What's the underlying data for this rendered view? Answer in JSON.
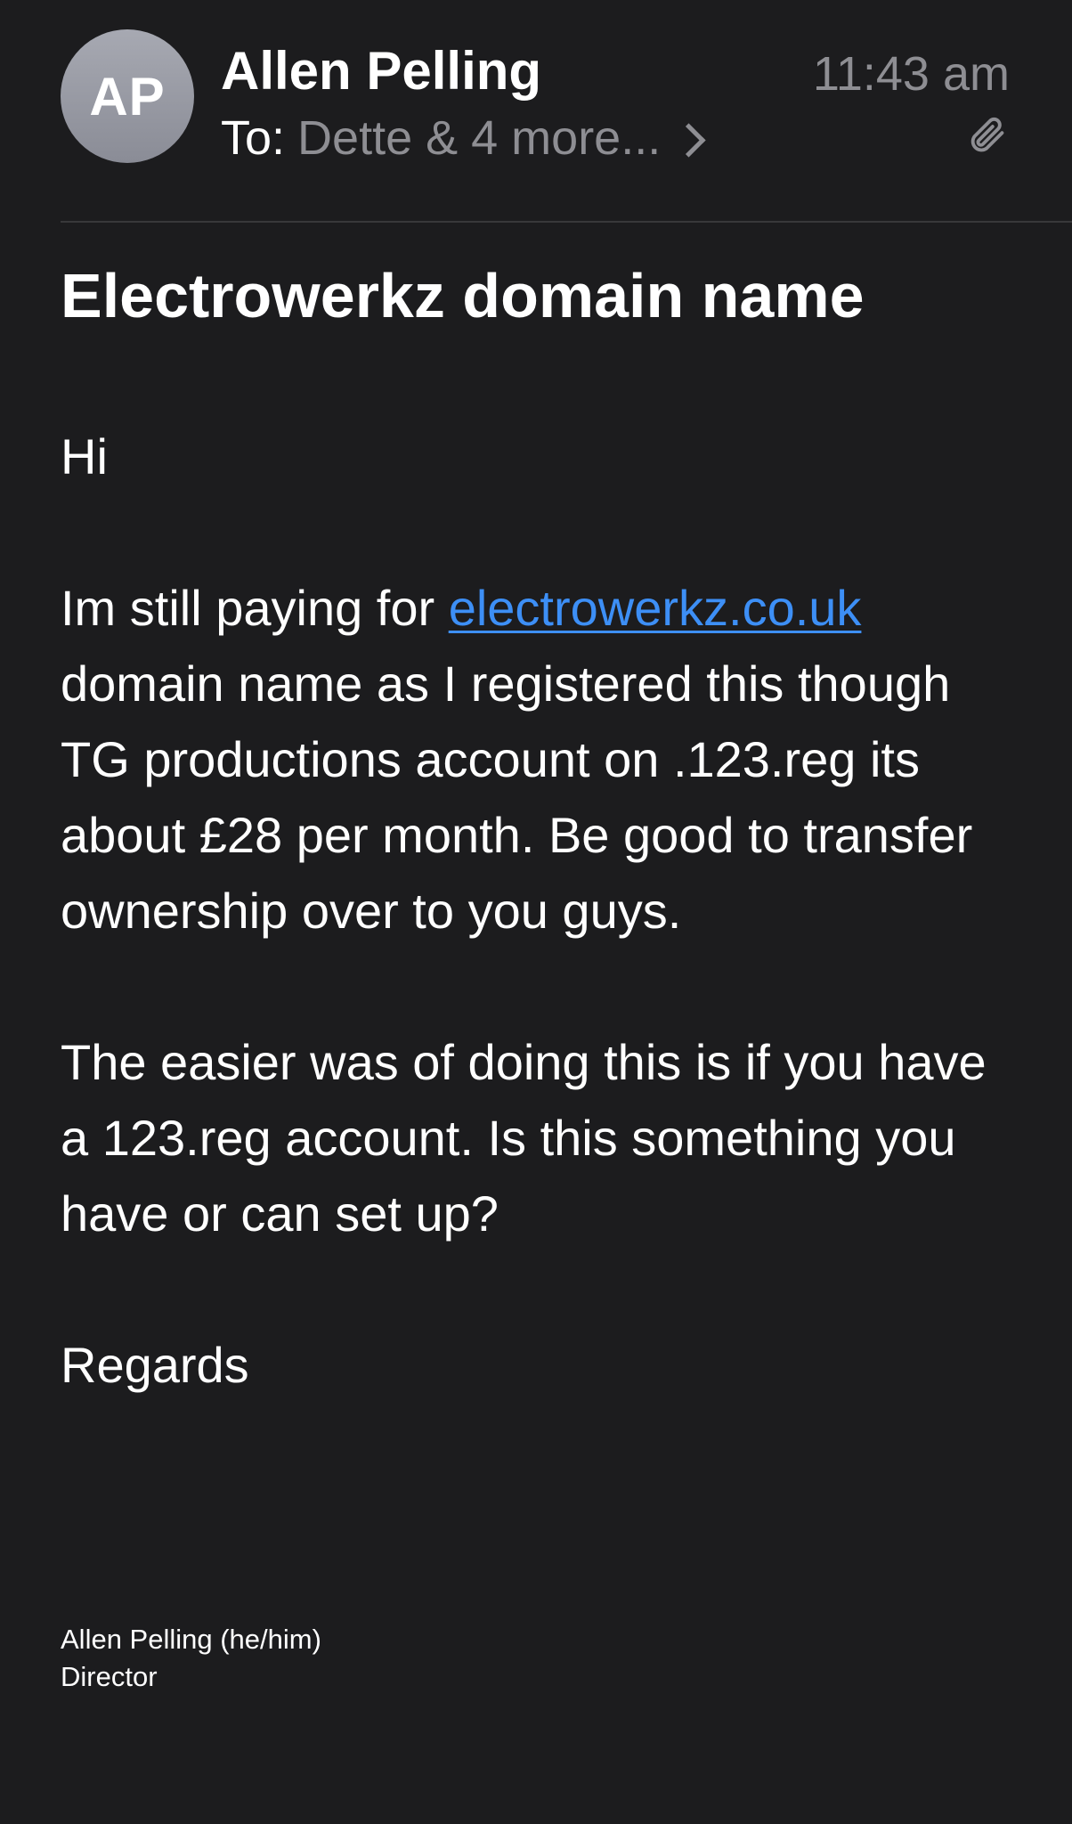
{
  "header": {
    "avatar_initials": "AP",
    "sender_name": "Allen Pelling",
    "to_label": "To:",
    "recipients": "Dette & 4 more...",
    "time": "11:43 am",
    "attachment_icon": "paperclip-icon"
  },
  "email": {
    "subject": "Electrowerkz domain name",
    "greeting": "Hi",
    "para1_before_link": "Im still paying for ",
    "para1_link": "electrowerkz.co.uk",
    "para1_after_link": " domain name as I registered this though TG productions account on .123.reg its about £28 per month. Be good to transfer ownership over to you guys.",
    "para2": "The easier was of doing this is if you have a 123.reg account. Is this something you have or can set up?",
    "closing": "Regards"
  },
  "signature": {
    "name": "Allen Pelling (he/him)",
    "title": "Director"
  },
  "colors": {
    "background": "#1c1c1e",
    "secondary_text": "#8e8e93",
    "link": "#3d8ff6"
  }
}
